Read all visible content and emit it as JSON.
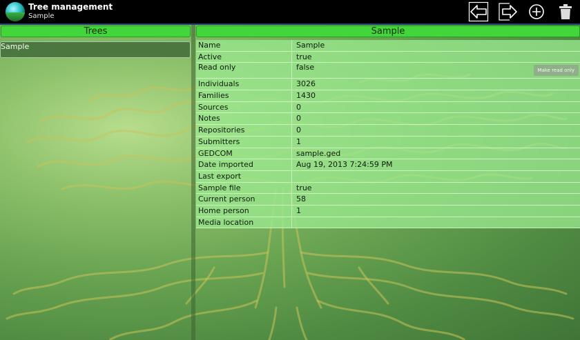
{
  "app": {
    "title": "Tree management",
    "subtitle": "Sample"
  },
  "actions": {
    "import_icon": "import-icon",
    "export_icon": "export-icon",
    "add_icon": "add-circle-icon",
    "delete_icon": "trash-icon"
  },
  "left": {
    "header": "Trees",
    "items": [
      "Sample"
    ]
  },
  "right": {
    "header": "Sample",
    "make_read_only_label": "Make read only",
    "rows": [
      {
        "label": "Name",
        "value": "Sample"
      },
      {
        "label": "Active",
        "value": "true"
      },
      {
        "label": "Read only",
        "value": "false"
      },
      {
        "label": "Individuals",
        "value": "3026"
      },
      {
        "label": "Families",
        "value": "1430"
      },
      {
        "label": "Sources",
        "value": "0"
      },
      {
        "label": "Notes",
        "value": "0"
      },
      {
        "label": "Repositories",
        "value": "0"
      },
      {
        "label": "Submitters",
        "value": "1"
      },
      {
        "label": "GEDCOM",
        "value": "sample.ged"
      },
      {
        "label": "Date imported",
        "value": "Aug 19, 2013 7:24:59 PM"
      },
      {
        "label": "Last export",
        "value": ""
      },
      {
        "label": "Sample file",
        "value": "true"
      },
      {
        "label": "Current person",
        "value": "58"
      },
      {
        "label": "Home person",
        "value": "1"
      },
      {
        "label": "Media location",
        "value": ""
      }
    ]
  },
  "colors": {
    "header_green": "#43d63a",
    "action_bar": "#000000",
    "row_green": "#9ae88e"
  }
}
